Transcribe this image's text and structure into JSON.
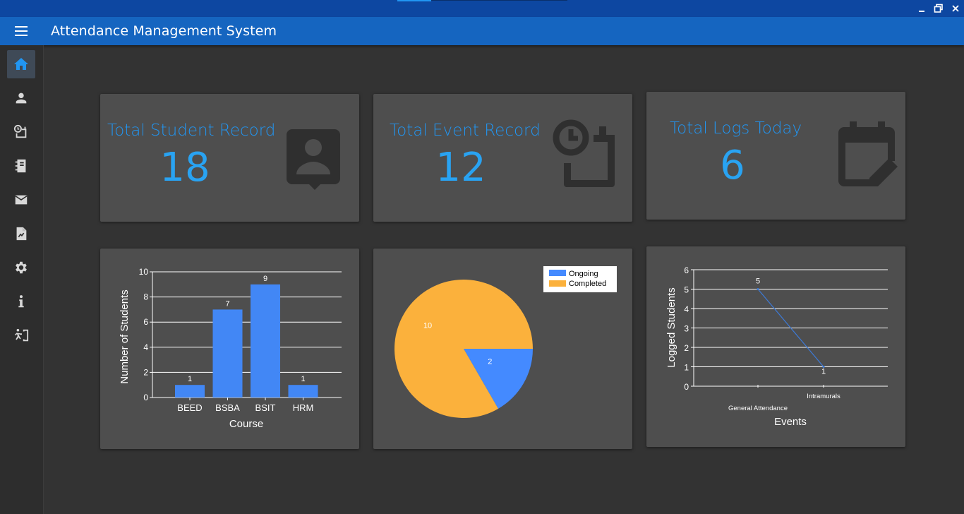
{
  "window": {
    "minimize_icon": "minimize-icon",
    "restore_icon": "restore-icon",
    "close_icon": "close-icon"
  },
  "appbar": {
    "title": "Attendance Management System",
    "menu_icon": "hamburger-menu-icon"
  },
  "sidebar": {
    "items": [
      {
        "icon": "home-icon",
        "active": true
      },
      {
        "icon": "person-icon",
        "active": false
      },
      {
        "icon": "event-clock-icon",
        "active": false
      },
      {
        "icon": "notebook-icon",
        "active": false
      },
      {
        "icon": "mail-icon",
        "active": false
      },
      {
        "icon": "report-file-icon",
        "active": false
      },
      {
        "icon": "settings-gear-icon",
        "active": false
      },
      {
        "icon": "info-icon",
        "active": false
      },
      {
        "icon": "logout-exit-icon",
        "active": false
      }
    ]
  },
  "stats": {
    "students": {
      "label": "Total Student Record",
      "value": "18",
      "icon": "contact-card-icon"
    },
    "events": {
      "label": "Total Event Record",
      "value": "12",
      "icon": "clock-calendar-icon"
    },
    "logs": {
      "label": "Total Logs Today",
      "value": "6",
      "icon": "calendar-edit-icon"
    }
  },
  "colors": {
    "accent": "#2196f3",
    "bar": "#4287f5",
    "ongoing": "#448aff",
    "completed": "#fbb13c",
    "card": "#4e4e4e",
    "background": "#333333",
    "appbar": "#1565c0",
    "titlebar": "#0d47a1"
  },
  "chart_data": [
    {
      "type": "bar",
      "title": "",
      "xlabel": "Course",
      "ylabel": "Number of Students",
      "categories": [
        "BEED",
        "BSBA",
        "BSIT",
        "HRM"
      ],
      "values": [
        1,
        7,
        9,
        1
      ],
      "value_labels": [
        "1",
        "7",
        "9",
        "1"
      ],
      "ylim": [
        0,
        10
      ],
      "yticks": [
        "0",
        "2",
        "4",
        "6",
        "8",
        "10"
      ],
      "grid": true
    },
    {
      "type": "pie",
      "title": "",
      "labels": [
        "Ongoing",
        "Completed"
      ],
      "values": [
        2,
        10
      ],
      "value_labels": [
        "2",
        "10"
      ],
      "legend": "top-right"
    },
    {
      "type": "line",
      "title": "",
      "xlabel": "Events",
      "ylabel": "Logged Students",
      "categories": [
        "General Attendance",
        "Intramurals"
      ],
      "values": [
        5,
        1
      ],
      "value_labels": [
        "5",
        "1"
      ],
      "ylim": [
        0,
        6
      ],
      "yticks": [
        "0",
        "1",
        "2",
        "3",
        "4",
        "5",
        "6"
      ],
      "grid": true
    }
  ]
}
